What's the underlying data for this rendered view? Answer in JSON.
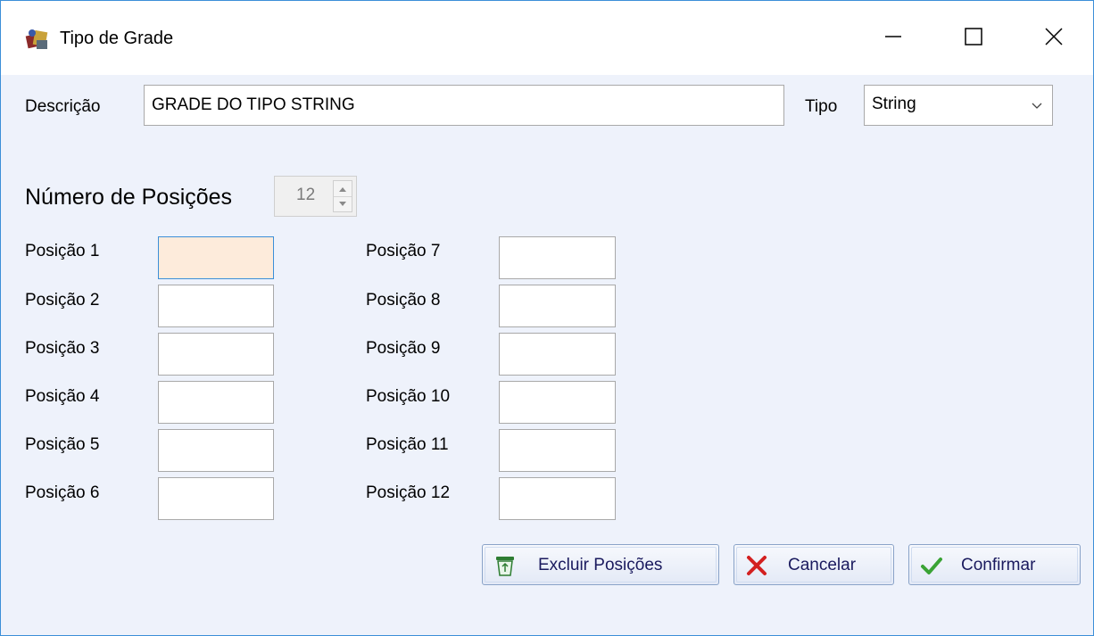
{
  "window": {
    "title": "Tipo de Grade",
    "icon": "app-icon",
    "controls": {
      "minimize_icon": "minimize-icon",
      "maximize_icon": "maximize-icon",
      "close_icon": "close-icon"
    }
  },
  "form": {
    "descricao_label": "Descrição",
    "descricao_value": "GRADE DO TIPO STRING",
    "tipo_label": "Tipo",
    "tipo_value": "String",
    "num_posicoes_label": "Número de Posições",
    "num_posicoes_value": "12",
    "positions": [
      {
        "label": "Posição 1",
        "value": ""
      },
      {
        "label": "Posição 2",
        "value": ""
      },
      {
        "label": "Posição 3",
        "value": ""
      },
      {
        "label": "Posição 4",
        "value": ""
      },
      {
        "label": "Posição 5",
        "value": ""
      },
      {
        "label": "Posição 6",
        "value": ""
      },
      {
        "label": "Posição 7",
        "value": ""
      },
      {
        "label": "Posição 8",
        "value": ""
      },
      {
        "label": "Posição 9",
        "value": ""
      },
      {
        "label": "Posição 10",
        "value": ""
      },
      {
        "label": "Posição 11",
        "value": ""
      },
      {
        "label": "Posição 12",
        "value": ""
      }
    ]
  },
  "buttons": {
    "excluir_label": "Excluir Posições",
    "excluir_icon": "recycle-bin-icon",
    "cancelar_label": "Cancelar",
    "cancelar_icon": "red-x-icon",
    "confirmar_label": "Confirmar",
    "confirmar_icon": "green-check-icon"
  },
  "colors": {
    "focused_field_bg": "#fdebdb",
    "window_bg": "#eef2fb",
    "border_accent": "#3c8fd8"
  }
}
